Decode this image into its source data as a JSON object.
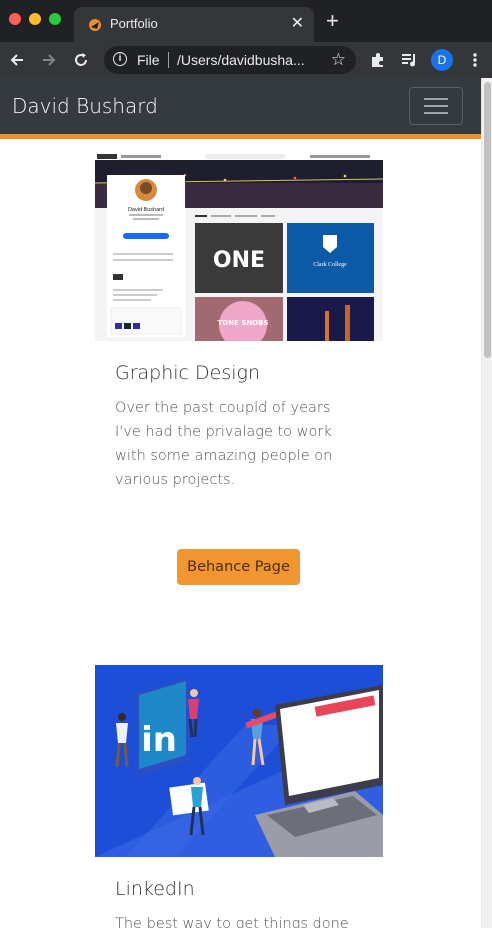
{
  "browser": {
    "tab_title": "Portfolio",
    "tab_close": "✕",
    "new_tab": "+",
    "url_scheme": "File",
    "url_path": "/Users/davidbusha...",
    "profile_initial": "D"
  },
  "site": {
    "brand": "David Bushard"
  },
  "behance_preview": {
    "name": "David Bushard",
    "follow_label": "Edit Your Profile",
    "tiles": [
      "Clark College",
      "TONE SNOBS"
    ]
  },
  "cards": [
    {
      "title": "Graphic Design",
      "text": "Over the past coupld of years I've had the privalage to work with some amazing people on various projects.",
      "button": "Behance Page"
    },
    {
      "title": "LinkedIn",
      "text": "The best way to get things done is"
    }
  ],
  "linkedin_logo": "in",
  "colors": {
    "navbar": "#343a40",
    "accent": "#e8902a",
    "button": "#f0952f",
    "linkedin_bg": "#1d4ed8"
  }
}
